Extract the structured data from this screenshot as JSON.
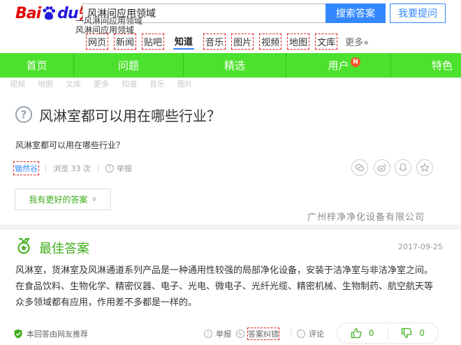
{
  "header": {
    "logo": {
      "bai": "Bai",
      "du": "du",
      "zhidao": "知道"
    },
    "search_value": "风淋间应用领域",
    "search_button": "搜索答案",
    "ask_button": "我要提问",
    "suggestion_line1": "一风淋间应用领域",
    "suggestion_line2": "风淋间应用领域"
  },
  "nav": {
    "items": [
      "网页",
      "新闻",
      "贴吧",
      "知道",
      "音乐",
      "图片",
      "视频",
      "地图",
      "文库",
      "更多»"
    ],
    "active_index": 3
  },
  "green_bar": {
    "items": [
      "首页",
      "问题",
      "精选",
      "用户",
      "特色"
    ],
    "badge": "N"
  },
  "ghost_row": [
    "视频",
    "地图",
    "文库",
    "更多",
    "知道",
    "音乐",
    "图片"
  ],
  "question": {
    "icon": "?",
    "title": "风淋室都可以用在哪些行业？",
    "description": "风淋室都可以用在哪些行业？",
    "user": "锄然谷",
    "views": "浏览 33 次",
    "report": "举报"
  },
  "share_icons": [
    "wechat-icon",
    "weibo-icon",
    "qq-icon",
    "favorite-star-icon"
  ],
  "better_answer_button": "我有更好的答案",
  "watermark": "广州梓净净化设备有限公司",
  "best_answer": {
    "title": "最佳答案",
    "date": "2017-09-25",
    "text": "风淋室，货淋室及风淋通道系列产品是一种通用性较强的局部净化设备，安装于洁净室与非洁净室之间。在食品饮料、生物化学、精密仪器、电子、光电、微电子、光纤光缆、精密机械、生物制药、航空航天等众多领域都有应用，作用差不多都是一样的。"
  },
  "footer": {
    "recommend": "本回答由网友推荐",
    "report": "举报",
    "correct": "答案纠错",
    "comment": "评论",
    "up_count": "0",
    "down_count": "0"
  },
  "colors": {
    "brand_blue": "#3388ff",
    "green_bar": "#4ce12d",
    "answer_green": "#3fae1d",
    "baidu_red": "#e10601"
  }
}
